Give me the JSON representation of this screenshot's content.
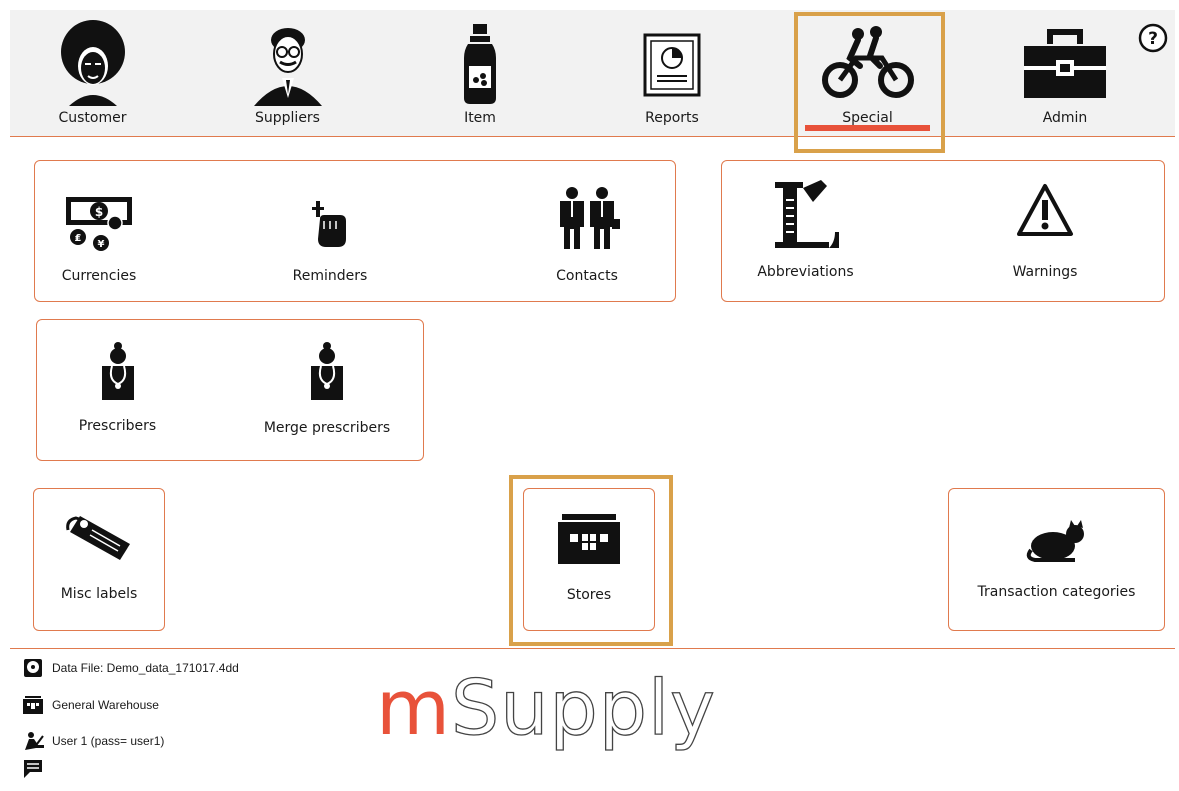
{
  "nav": {
    "tabs": [
      {
        "label": "Customer",
        "icon": "afro-person-icon"
      },
      {
        "label": "Suppliers",
        "icon": "businessman-icon"
      },
      {
        "label": "Item",
        "icon": "medicine-bottle-icon"
      },
      {
        "label": "Reports",
        "icon": "report-chart-icon"
      },
      {
        "label": "Special",
        "icon": "tandem-bicycle-icon",
        "active": true
      },
      {
        "label": "Admin",
        "icon": "toolbox-icon"
      }
    ],
    "help_label": "?",
    "active_color": "#e8523a",
    "highlight_color": "#d9a14a"
  },
  "buttons": {
    "currencies": "Currencies",
    "reminders": "Reminders",
    "contacts": "Contacts",
    "abbreviations": "Abbreviations",
    "warnings": "Warnings",
    "prescribers": "Prescribers",
    "merge_prescribers": "Merge prescribers",
    "misc_labels": "Misc labels",
    "stores": "Stores",
    "transaction_categories": "Transaction categories"
  },
  "status": {
    "data_file": "Data File: Demo_data_171017.4dd",
    "store": "General Warehouse",
    "user": "User 1 (pass= user1)"
  },
  "logo": {
    "m": "m",
    "rest": "Supply"
  }
}
